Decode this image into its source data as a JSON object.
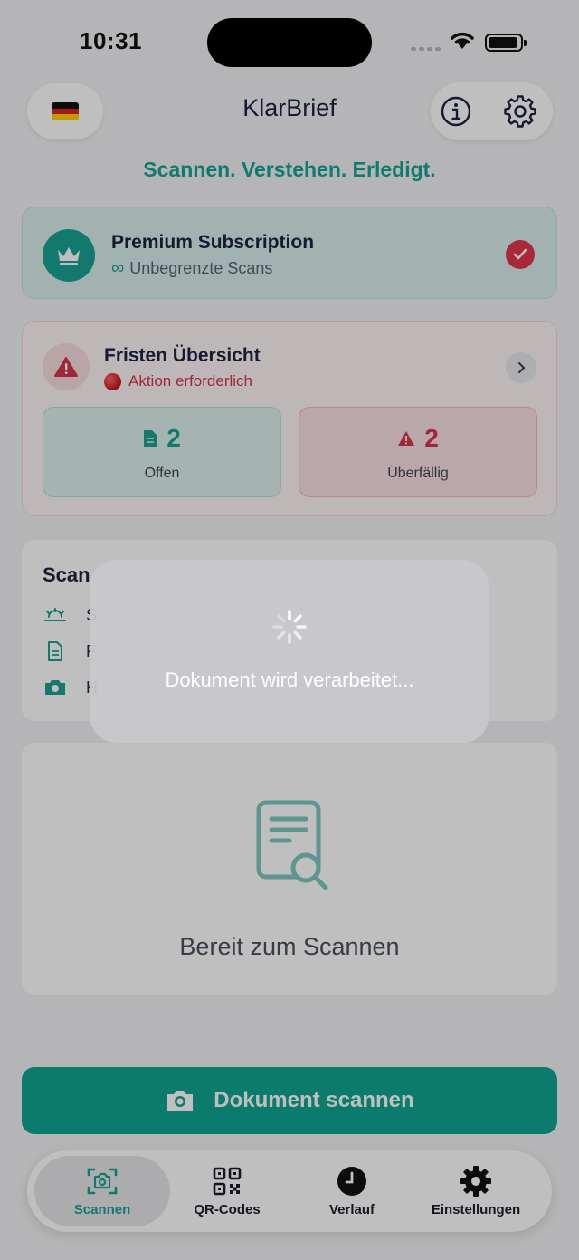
{
  "status_bar": {
    "time": "10:31"
  },
  "header": {
    "title": "KlarBrief",
    "tagline": "Scannen. Verstehen. Erledigt.",
    "language_flag": "german-flag-icon"
  },
  "premium": {
    "title": "Premium Subscription",
    "subtitle": "Unbegrenzte Scans",
    "active": true
  },
  "deadlines": {
    "title": "Fristen Übersicht",
    "status": "Aktion erforderlich",
    "open_count": "2",
    "open_label": "Offen",
    "overdue_count": "2",
    "overdue_label": "Überfällig"
  },
  "tips": {
    "title": "Scan"
  },
  "ready": {
    "label": "Bereit zum Scannen"
  },
  "scan_button": {
    "label": "Dokument scannen"
  },
  "tab_bar": {
    "tabs": [
      {
        "label": "Scannen",
        "icon": "camera-scan-icon",
        "active": true
      },
      {
        "label": "QR-Codes",
        "icon": "qr-code-icon",
        "active": false
      },
      {
        "label": "Verlauf",
        "icon": "clock-icon",
        "active": false
      },
      {
        "label": "Einstellungen",
        "icon": "gear-icon",
        "active": false
      }
    ]
  },
  "loading": {
    "message": "Dokument wird verarbeitet..."
  },
  "colors": {
    "accent": "#14a394",
    "danger": "#d6354c",
    "scan_button": "#0fa592"
  }
}
